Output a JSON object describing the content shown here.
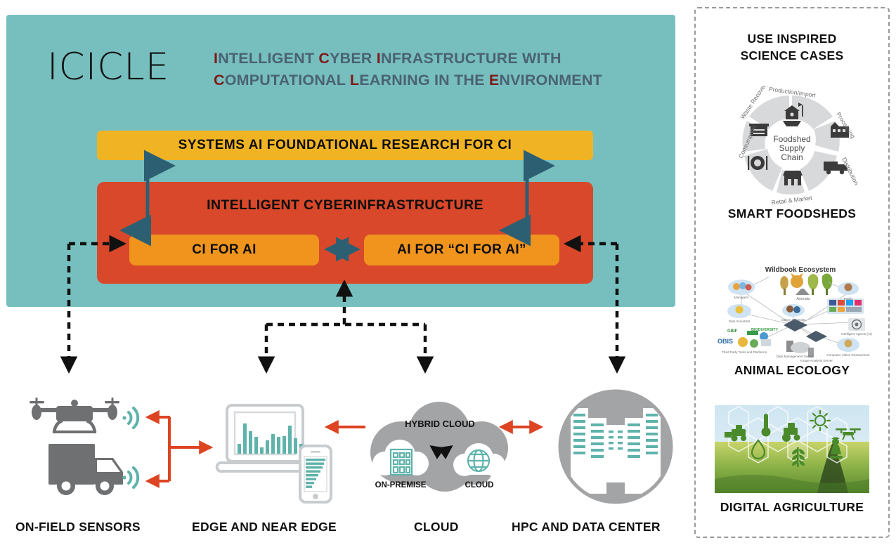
{
  "header": {
    "logo": "ICICLE",
    "tagline_line1": [
      {
        "cap": "I",
        "rest": "NTELLIGENT "
      },
      {
        "cap": "C",
        "rest": "YBER "
      },
      {
        "cap": "I",
        "rest": "NFRASTRUCTURE WITH"
      }
    ],
    "tagline_line2": [
      {
        "cap": "C",
        "rest": "OMPUTATIONAL "
      },
      {
        "cap": "L",
        "rest": "EARNING IN THE "
      },
      {
        "cap": "E",
        "rest": "NVIRONMENT"
      }
    ],
    "tagline_plain": "INTELLIGENT CYBER INFRASTRUCTURE WITH COMPUTATIONAL LEARNING IN THE ENVIRONMENT"
  },
  "stack": {
    "foundational_research": "SYSTEMS AI FOUNDATIONAL RESEARCH FOR CI",
    "intelligent_ci": "INTELLIGENT CYBERINFRASTRUCTURE",
    "ci_for_ai": "CI FOR AI",
    "ai_for_ci_for_ai": "AI FOR “CI FOR AI”"
  },
  "tiers": [
    {
      "id": "on-field-sensors",
      "label": "ON-FIELD SENSORS",
      "icons": [
        "drone-icon",
        "wifi-signal-icon",
        "truck-icon",
        "wifi-signal-icon"
      ]
    },
    {
      "id": "edge-near-edge",
      "label": "EDGE AND NEAR EDGE",
      "icons": [
        "laptop-icon",
        "bar-chart-icon",
        "smartphone-icon"
      ]
    },
    {
      "id": "cloud",
      "label": "CLOUD",
      "icons": [
        "cloud-icon",
        "building-icon",
        "globe-icon"
      ],
      "cloud_title": "HYBRID CLOUD",
      "sub_left": "ON-PREMISE",
      "sub_right": "CLOUD"
    },
    {
      "id": "hpc-data-center",
      "label": "HPC AND DATA CENTER",
      "icons": [
        "server-rack-icon"
      ]
    }
  ],
  "sidebar": {
    "title_line1": "USE INSPIRED",
    "title_line2": "SCIENCE CASES",
    "cases": [
      {
        "id": "smart-foodsheds",
        "label": "SMART FOODSHEDS",
        "art": {
          "center_line1": "Foodshed",
          "center_line2": "Supply",
          "center_line3": "Chain",
          "stages": [
            "Production/Import",
            "Processing",
            "Distribution",
            "Retail & Market",
            "Consumption",
            "Waste Recovery"
          ]
        }
      },
      {
        "id": "animal-ecology",
        "label": "ANIMAL ECOLOGY",
        "art": {
          "title": "Wildbook Ecosystem",
          "nodes": [
            "Managers",
            "Data Scientists",
            "Citizen Scientists",
            "Public",
            "Intelligent Agents (AI)",
            "Data Management Server",
            "Image Analysis Server",
            "Computer Vision Researchers",
            "Third Party Tools and Platforms",
            "Animals"
          ],
          "platform_logos": [
            "GBIF",
            "BIODIVERSITY",
            "iNaturalist",
            "OBIS",
            "Zooniverse"
          ]
        }
      },
      {
        "id": "digital-agriculture",
        "label": "DIGITAL AGRICULTURE",
        "art": {
          "hex_icons": [
            "combine-harvester-icon",
            "thermometer-icon",
            "tractor-icon",
            "sun-icon",
            "drone-icon",
            "water-drop-icon",
            "wheat-icon",
            "farmer-icon"
          ]
        }
      }
    ]
  },
  "colors": {
    "teal_panel": "#77bfbf",
    "yellow_bar": "#f0b323",
    "red_box": "#d9482a",
    "orange_box": "#f0941e",
    "blue_arrow": "#2d5f72",
    "red_arrow": "#dd4422",
    "icon_gray": "#6f7072",
    "icon_teal": "#5fb3ab",
    "tagline_blue": "#4a6273",
    "cap_maroon": "#7d1b18"
  }
}
